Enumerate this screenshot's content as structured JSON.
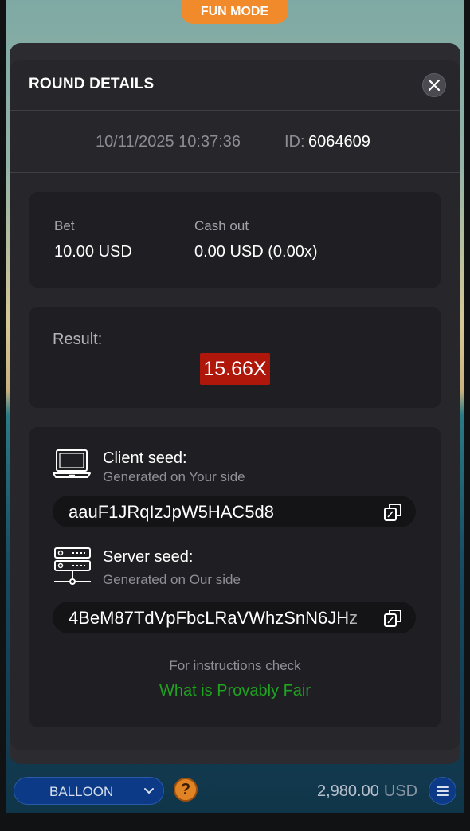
{
  "game": {
    "mode_badge": "FUN MODE"
  },
  "modal": {
    "title": "ROUND DETAILS",
    "date": "10/11/2025 10:37:36",
    "id_label": "ID:",
    "id_value": "6064609",
    "bet_label": "Bet",
    "bet_value": "10.00 USD",
    "cashout_label": "Cash out",
    "cashout_value": "0.00 USD (0.00x)",
    "result_label": "Result:",
    "result_value": "15.66X",
    "client_seed": {
      "title": "Client seed:",
      "subtitle": "Generated on Your side",
      "value": "aauF1JRqIzJpW5HAC5d8",
      "icon": "laptop-icon"
    },
    "server_seed": {
      "title": "Server seed:",
      "subtitle": "Generated on Our side",
      "value": "4BeM87TdVpFbcLRaVWhzSnN6JHz",
      "icon": "server-icon"
    },
    "instructions": "For instructions check",
    "provably_fair_link": "What is Provably Fair"
  },
  "bottom_bar": {
    "game_selector": "BALLOON",
    "help_icon": "?",
    "balance_amount": "2,980.00",
    "balance_currency": "USD"
  },
  "colors": {
    "accent_orange": "#f08a2b",
    "result_red": "#b0170b",
    "link_green": "#1fa320",
    "selector_blue": "#0c3a86"
  }
}
